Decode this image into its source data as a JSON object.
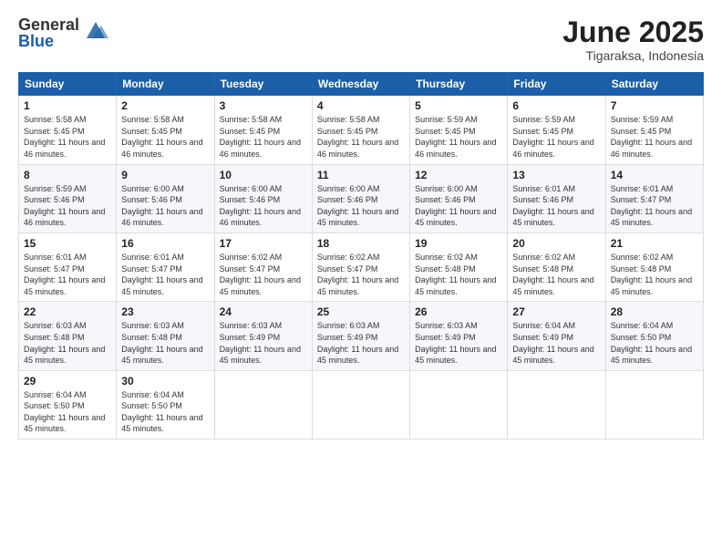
{
  "logo": {
    "general": "General",
    "blue": "Blue"
  },
  "title": "June 2025",
  "location": "Tigaraksa, Indonesia",
  "days_of_week": [
    "Sunday",
    "Monday",
    "Tuesday",
    "Wednesday",
    "Thursday",
    "Friday",
    "Saturday"
  ],
  "weeks": [
    [
      {
        "day": 1,
        "sunrise": "5:58 AM",
        "sunset": "5:45 PM",
        "daylight": "11 hours and 46 minutes."
      },
      {
        "day": 2,
        "sunrise": "5:58 AM",
        "sunset": "5:45 PM",
        "daylight": "11 hours and 46 minutes."
      },
      {
        "day": 3,
        "sunrise": "5:58 AM",
        "sunset": "5:45 PM",
        "daylight": "11 hours and 46 minutes."
      },
      {
        "day": 4,
        "sunrise": "5:58 AM",
        "sunset": "5:45 PM",
        "daylight": "11 hours and 46 minutes."
      },
      {
        "day": 5,
        "sunrise": "5:59 AM",
        "sunset": "5:45 PM",
        "daylight": "11 hours and 46 minutes."
      },
      {
        "day": 6,
        "sunrise": "5:59 AM",
        "sunset": "5:45 PM",
        "daylight": "11 hours and 46 minutes."
      },
      {
        "day": 7,
        "sunrise": "5:59 AM",
        "sunset": "5:45 PM",
        "daylight": "11 hours and 46 minutes."
      }
    ],
    [
      {
        "day": 8,
        "sunrise": "5:59 AM",
        "sunset": "5:46 PM",
        "daylight": "11 hours and 46 minutes."
      },
      {
        "day": 9,
        "sunrise": "6:00 AM",
        "sunset": "5:46 PM",
        "daylight": "11 hours and 46 minutes."
      },
      {
        "day": 10,
        "sunrise": "6:00 AM",
        "sunset": "5:46 PM",
        "daylight": "11 hours and 46 minutes."
      },
      {
        "day": 11,
        "sunrise": "6:00 AM",
        "sunset": "5:46 PM",
        "daylight": "11 hours and 45 minutes."
      },
      {
        "day": 12,
        "sunrise": "6:00 AM",
        "sunset": "5:46 PM",
        "daylight": "11 hours and 45 minutes."
      },
      {
        "day": 13,
        "sunrise": "6:01 AM",
        "sunset": "5:46 PM",
        "daylight": "11 hours and 45 minutes."
      },
      {
        "day": 14,
        "sunrise": "6:01 AM",
        "sunset": "5:47 PM",
        "daylight": "11 hours and 45 minutes."
      }
    ],
    [
      {
        "day": 15,
        "sunrise": "6:01 AM",
        "sunset": "5:47 PM",
        "daylight": "11 hours and 45 minutes."
      },
      {
        "day": 16,
        "sunrise": "6:01 AM",
        "sunset": "5:47 PM",
        "daylight": "11 hours and 45 minutes."
      },
      {
        "day": 17,
        "sunrise": "6:02 AM",
        "sunset": "5:47 PM",
        "daylight": "11 hours and 45 minutes."
      },
      {
        "day": 18,
        "sunrise": "6:02 AM",
        "sunset": "5:47 PM",
        "daylight": "11 hours and 45 minutes."
      },
      {
        "day": 19,
        "sunrise": "6:02 AM",
        "sunset": "5:48 PM",
        "daylight": "11 hours and 45 minutes."
      },
      {
        "day": 20,
        "sunrise": "6:02 AM",
        "sunset": "5:48 PM",
        "daylight": "11 hours and 45 minutes."
      },
      {
        "day": 21,
        "sunrise": "6:02 AM",
        "sunset": "5:48 PM",
        "daylight": "11 hours and 45 minutes."
      }
    ],
    [
      {
        "day": 22,
        "sunrise": "6:03 AM",
        "sunset": "5:48 PM",
        "daylight": "11 hours and 45 minutes."
      },
      {
        "day": 23,
        "sunrise": "6:03 AM",
        "sunset": "5:48 PM",
        "daylight": "11 hours and 45 minutes."
      },
      {
        "day": 24,
        "sunrise": "6:03 AM",
        "sunset": "5:49 PM",
        "daylight": "11 hours and 45 minutes."
      },
      {
        "day": 25,
        "sunrise": "6:03 AM",
        "sunset": "5:49 PM",
        "daylight": "11 hours and 45 minutes."
      },
      {
        "day": 26,
        "sunrise": "6:03 AM",
        "sunset": "5:49 PM",
        "daylight": "11 hours and 45 minutes."
      },
      {
        "day": 27,
        "sunrise": "6:04 AM",
        "sunset": "5:49 PM",
        "daylight": "11 hours and 45 minutes."
      },
      {
        "day": 28,
        "sunrise": "6:04 AM",
        "sunset": "5:50 PM",
        "daylight": "11 hours and 45 minutes."
      }
    ],
    [
      {
        "day": 29,
        "sunrise": "6:04 AM",
        "sunset": "5:50 PM",
        "daylight": "11 hours and 45 minutes."
      },
      {
        "day": 30,
        "sunrise": "6:04 AM",
        "sunset": "5:50 PM",
        "daylight": "11 hours and 45 minutes."
      },
      null,
      null,
      null,
      null,
      null
    ]
  ]
}
